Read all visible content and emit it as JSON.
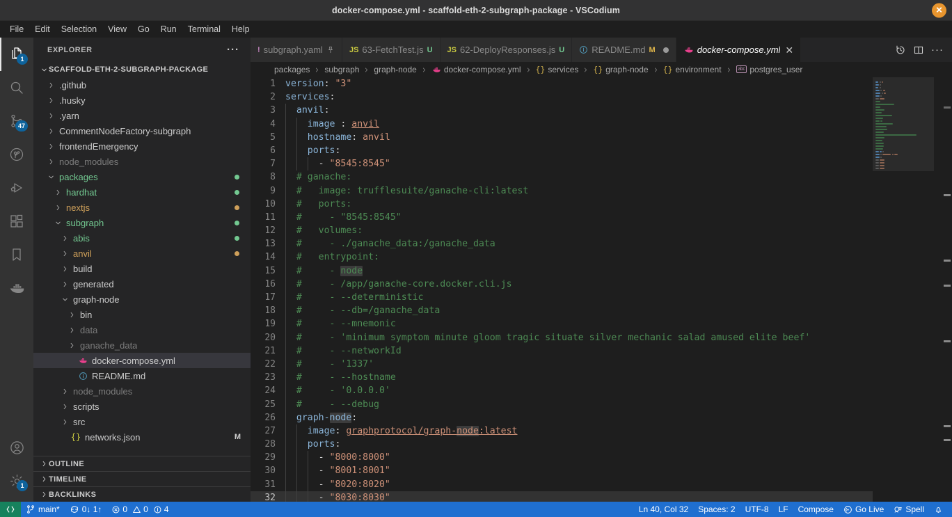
{
  "window": {
    "title": "docker-compose.yml - scaffold-eth-2-subgraph-package - VSCodium",
    "close_label": "✕"
  },
  "menubar": {
    "items": [
      "File",
      "Edit",
      "Selection",
      "View",
      "Go",
      "Run",
      "Terminal",
      "Help"
    ]
  },
  "activitybar": {
    "items": [
      {
        "name": "explorer",
        "icon": "files-icon",
        "badge": "1",
        "active": true
      },
      {
        "name": "search",
        "icon": "search-icon",
        "badge": "",
        "active": false
      },
      {
        "name": "source-control",
        "icon": "source-control-icon",
        "badge": "47",
        "active": false
      },
      {
        "name": "remote-explorer",
        "icon": "remote-explorer-icon",
        "badge": "",
        "active": false
      },
      {
        "name": "run-and-debug",
        "icon": "run-debug-icon",
        "badge": "",
        "active": false
      },
      {
        "name": "extensions",
        "icon": "extensions-icon",
        "badge": "",
        "active": false
      },
      {
        "name": "bookmarks",
        "icon": "bookmark-icon",
        "badge": "",
        "active": false
      },
      {
        "name": "docker",
        "icon": "docker-icon",
        "badge": "",
        "active": false
      }
    ],
    "bottom": [
      {
        "name": "accounts",
        "icon": "account-icon",
        "badge": ""
      },
      {
        "name": "manage",
        "icon": "gear-icon",
        "badge": "1"
      }
    ]
  },
  "sidebar": {
    "header_title": "EXPLORER",
    "more_actions": "···",
    "root_label": "SCAFFOLD-ETH-2-SUBGRAPH-PACKAGE",
    "tree": [
      {
        "label": ".github",
        "depth": 1,
        "type": "folder",
        "expanded": false,
        "color": "#cccccc",
        "dot": "",
        "badge": ""
      },
      {
        "label": ".husky",
        "depth": 1,
        "type": "folder",
        "expanded": false,
        "color": "#cccccc",
        "dot": "",
        "badge": ""
      },
      {
        "label": ".yarn",
        "depth": 1,
        "type": "folder",
        "expanded": false,
        "color": "#cccccc",
        "dot": "",
        "badge": ""
      },
      {
        "label": "CommentNodeFactory-subgraph",
        "depth": 1,
        "type": "folder",
        "expanded": false,
        "color": "#cccccc",
        "dot": "",
        "badge": ""
      },
      {
        "label": "frontendEmergency",
        "depth": 1,
        "type": "folder",
        "expanded": false,
        "color": "#cccccc",
        "dot": "",
        "badge": ""
      },
      {
        "label": "node_modules",
        "depth": 1,
        "type": "folder",
        "expanded": false,
        "color": "#7c7c7c",
        "dot": "",
        "badge": ""
      },
      {
        "label": "packages",
        "depth": 1,
        "type": "folder",
        "expanded": true,
        "color": "#73c991",
        "dot": "#73c991",
        "badge": ""
      },
      {
        "label": "hardhat",
        "depth": 2,
        "type": "folder",
        "expanded": false,
        "color": "#73c991",
        "dot": "#73c991",
        "badge": ""
      },
      {
        "label": "nextjs",
        "depth": 2,
        "type": "folder",
        "expanded": false,
        "color": "#cfa05a",
        "dot": "#cfa05a",
        "badge": ""
      },
      {
        "label": "subgraph",
        "depth": 2,
        "type": "folder",
        "expanded": true,
        "color": "#73c991",
        "dot": "#73c991",
        "badge": ""
      },
      {
        "label": "abis",
        "depth": 3,
        "type": "folder",
        "expanded": false,
        "color": "#73c991",
        "dot": "#73c991",
        "badge": ""
      },
      {
        "label": "anvil",
        "depth": 3,
        "type": "folder",
        "expanded": false,
        "color": "#cfa05a",
        "dot": "#cfa05a",
        "badge": ""
      },
      {
        "label": "build",
        "depth": 3,
        "type": "folder",
        "expanded": false,
        "color": "#cccccc",
        "dot": "",
        "badge": ""
      },
      {
        "label": "generated",
        "depth": 3,
        "type": "folder",
        "expanded": false,
        "color": "#cccccc",
        "dot": "",
        "badge": ""
      },
      {
        "label": "graph-node",
        "depth": 3,
        "type": "folder",
        "expanded": true,
        "color": "#cccccc",
        "dot": "",
        "badge": ""
      },
      {
        "label": "bin",
        "depth": 4,
        "type": "folder",
        "expanded": false,
        "color": "#cccccc",
        "dot": "",
        "badge": ""
      },
      {
        "label": "data",
        "depth": 4,
        "type": "folder",
        "expanded": false,
        "color": "#7c7c7c",
        "dot": "",
        "badge": ""
      },
      {
        "label": "ganache_data",
        "depth": 4,
        "type": "folder",
        "expanded": false,
        "color": "#7c7c7c",
        "dot": "",
        "badge": ""
      },
      {
        "label": "docker-compose.yml",
        "depth": 4,
        "type": "docker-file",
        "expanded": false,
        "color": "#cccccc",
        "dot": "",
        "badge": "",
        "selected": true
      },
      {
        "label": "README.md",
        "depth": 4,
        "type": "info-file",
        "expanded": false,
        "color": "#cccccc",
        "dot": "",
        "badge": ""
      },
      {
        "label": "node_modules",
        "depth": 3,
        "type": "folder",
        "expanded": false,
        "color": "#7c7c7c",
        "dot": "",
        "badge": ""
      },
      {
        "label": "scripts",
        "depth": 3,
        "type": "folder",
        "expanded": false,
        "color": "#cccccc",
        "dot": "",
        "badge": ""
      },
      {
        "label": "src",
        "depth": 3,
        "type": "folder",
        "expanded": false,
        "color": "#cccccc",
        "dot": "",
        "badge": ""
      },
      {
        "label": "networks.json",
        "depth": 3,
        "type": "json-file",
        "expanded": false,
        "color": "#cccccc",
        "dot": "",
        "badge": "M"
      }
    ],
    "sections": [
      "OUTLINE",
      "TIMELINE",
      "BACKLINKS"
    ]
  },
  "tabs": [
    {
      "label": "subgraph.yaml",
      "icon": "!",
      "icon_color": "#c586c0",
      "state": "pin",
      "state_text": "",
      "active": false
    },
    {
      "label": "63-FetchTest.js",
      "icon": "JS",
      "icon_color": "#cbcb41",
      "state": "u",
      "state_text": "U",
      "active": false
    },
    {
      "label": "62-DeployResponses.js",
      "icon": "JS",
      "icon_color": "#cbcb41",
      "state": "u",
      "state_text": "U",
      "active": false
    },
    {
      "label": "README.md",
      "icon": "i",
      "icon_color": "#519aba",
      "state": "mod",
      "state_text": "M",
      "active": false
    },
    {
      "label": "docker-compose.yml",
      "icon": "docker",
      "icon_color": "#e83f8c",
      "state": "close",
      "state_text": "✕",
      "active": true
    }
  ],
  "tabbar_actions": [
    "history-icon",
    "split-editor-icon",
    "more-actions-icon"
  ],
  "breadcrumbs": [
    {
      "label": "packages",
      "icon": ""
    },
    {
      "label": "subgraph",
      "icon": ""
    },
    {
      "label": "graph-node",
      "icon": ""
    },
    {
      "label": "docker-compose.yml",
      "icon": "docker"
    },
    {
      "label": "services",
      "icon": "braces"
    },
    {
      "label": "graph-node",
      "icon": "braces"
    },
    {
      "label": "environment",
      "icon": "braces"
    },
    {
      "label": "postgres_user",
      "icon": "abc"
    }
  ],
  "editor": {
    "search_term": "node",
    "first_line": 1,
    "current_line": 32,
    "lines": [
      {
        "n": 1,
        "indent": 0,
        "tokens": [
          {
            "t": "version",
            "c": "k"
          },
          {
            "t": ": ",
            "c": "p"
          },
          {
            "t": "\"3\"",
            "c": "v"
          }
        ]
      },
      {
        "n": 2,
        "indent": 0,
        "tokens": [
          {
            "t": "services",
            "c": "k"
          },
          {
            "t": ":",
            "c": "p"
          }
        ]
      },
      {
        "n": 3,
        "indent": 1,
        "tokens": [
          {
            "t": "  anvil",
            "c": "k"
          },
          {
            "t": ":",
            "c": "p"
          }
        ]
      },
      {
        "n": 4,
        "indent": 2,
        "tokens": [
          {
            "t": "    image ",
            "c": "k"
          },
          {
            "t": ": ",
            "c": "p"
          },
          {
            "t": "anvil",
            "c": "v ulink"
          }
        ]
      },
      {
        "n": 5,
        "indent": 2,
        "tokens": [
          {
            "t": "    hostname",
            "c": "k"
          },
          {
            "t": ": ",
            "c": "p"
          },
          {
            "t": "anvil",
            "c": "v"
          }
        ]
      },
      {
        "n": 6,
        "indent": 2,
        "tokens": [
          {
            "t": "    ports",
            "c": "k"
          },
          {
            "t": ":",
            "c": "p"
          }
        ]
      },
      {
        "n": 7,
        "indent": 3,
        "tokens": [
          {
            "t": "      - ",
            "c": "p"
          },
          {
            "t": "\"8545:8545\"",
            "c": "v"
          }
        ]
      },
      {
        "n": 8,
        "indent": 1,
        "tokens": [
          {
            "t": "  # ganache:",
            "c": "c"
          }
        ]
      },
      {
        "n": 9,
        "indent": 1,
        "tokens": [
          {
            "t": "  #   image: trufflesuite/ganache-cli:latest",
            "c": "c"
          }
        ]
      },
      {
        "n": 10,
        "indent": 1,
        "tokens": [
          {
            "t": "  #   ports:",
            "c": "c"
          }
        ]
      },
      {
        "n": 11,
        "indent": 1,
        "tokens": [
          {
            "t": "  #     - \"8545:8545\"",
            "c": "c"
          }
        ]
      },
      {
        "n": 12,
        "indent": 1,
        "tokens": [
          {
            "t": "  #   volumes:",
            "c": "c"
          }
        ]
      },
      {
        "n": 13,
        "indent": 1,
        "tokens": [
          {
            "t": "  #     - ./ganache_data:/ganache_data",
            "c": "c"
          }
        ]
      },
      {
        "n": 14,
        "indent": 1,
        "tokens": [
          {
            "t": "  #   entrypoint:",
            "c": "c"
          }
        ]
      },
      {
        "n": 15,
        "indent": 1,
        "tokens": [
          {
            "t": "  #     - ",
            "c": "c"
          },
          {
            "t": "node",
            "c": "c hl"
          }
        ]
      },
      {
        "n": 16,
        "indent": 1,
        "tokens": [
          {
            "t": "  #     - /app/ganache-core.docker.cli.js",
            "c": "c"
          }
        ]
      },
      {
        "n": 17,
        "indent": 1,
        "tokens": [
          {
            "t": "  #     - --deterministic",
            "c": "c"
          }
        ]
      },
      {
        "n": 18,
        "indent": 1,
        "tokens": [
          {
            "t": "  #     - --db=/ganache_data",
            "c": "c"
          }
        ]
      },
      {
        "n": 19,
        "indent": 1,
        "tokens": [
          {
            "t": "  #     - --mnemonic",
            "c": "c"
          }
        ]
      },
      {
        "n": 20,
        "indent": 1,
        "tokens": [
          {
            "t": "  #     - 'minimum symptom minute gloom tragic situate silver mechanic salad amused elite beef'",
            "c": "c"
          }
        ]
      },
      {
        "n": 21,
        "indent": 1,
        "tokens": [
          {
            "t": "  #     - --networkId",
            "c": "c"
          }
        ]
      },
      {
        "n": 22,
        "indent": 1,
        "tokens": [
          {
            "t": "  #     - '1337'",
            "c": "c"
          }
        ]
      },
      {
        "n": 23,
        "indent": 1,
        "tokens": [
          {
            "t": "  #     - --hostname",
            "c": "c"
          }
        ]
      },
      {
        "n": 24,
        "indent": 1,
        "tokens": [
          {
            "t": "  #     - '0.0.0.0'",
            "c": "c"
          }
        ]
      },
      {
        "n": 25,
        "indent": 1,
        "tokens": [
          {
            "t": "  #     - --debug",
            "c": "c"
          }
        ]
      },
      {
        "n": 26,
        "indent": 1,
        "tokens": [
          {
            "t": "  graph-",
            "c": "k"
          },
          {
            "t": "node",
            "c": "k hl"
          },
          {
            "t": ":",
            "c": "p"
          }
        ]
      },
      {
        "n": 27,
        "indent": 2,
        "tokens": [
          {
            "t": "    image",
            "c": "k"
          },
          {
            "t": ": ",
            "c": "p"
          },
          {
            "t": "graphprotocol/graph-",
            "c": "v ulink"
          },
          {
            "t": "node",
            "c": "v ulink hl"
          },
          {
            "t": ":latest",
            "c": "v ulink"
          }
        ]
      },
      {
        "n": 28,
        "indent": 2,
        "tokens": [
          {
            "t": "    ports",
            "c": "k"
          },
          {
            "t": ":",
            "c": "p"
          }
        ]
      },
      {
        "n": 29,
        "indent": 3,
        "tokens": [
          {
            "t": "      - ",
            "c": "p"
          },
          {
            "t": "\"8000:8000\"",
            "c": "v"
          }
        ]
      },
      {
        "n": 30,
        "indent": 3,
        "tokens": [
          {
            "t": "      - ",
            "c": "p"
          },
          {
            "t": "\"8001:8001\"",
            "c": "v"
          }
        ]
      },
      {
        "n": 31,
        "indent": 3,
        "tokens": [
          {
            "t": "      - ",
            "c": "p"
          },
          {
            "t": "\"8020:8020\"",
            "c": "v"
          }
        ]
      },
      {
        "n": 32,
        "indent": 3,
        "tokens": [
          {
            "t": "      - ",
            "c": "p"
          },
          {
            "t": "\"8030:8030\"",
            "c": "v"
          }
        ],
        "current": true
      }
    ]
  },
  "statusbar": {
    "remote_icon": "remote-indicator-icon",
    "left": [
      {
        "name": "branch",
        "icon": "git-branch-icon",
        "text": "main*"
      },
      {
        "name": "sync",
        "icon": "sync-icon",
        "text": "0↓ 1↑"
      },
      {
        "name": "problems",
        "icon": "errors-icon",
        "text": "0  0  4"
      }
    ],
    "errors_count": "0",
    "warnings_count": "0",
    "infos_count": "4",
    "right": [
      {
        "name": "cursor-position",
        "text": "Ln 40, Col 32"
      },
      {
        "name": "indentation",
        "text": "Spaces: 2"
      },
      {
        "name": "encoding",
        "text": "UTF-8"
      },
      {
        "name": "eol",
        "text": "LF"
      },
      {
        "name": "language-mode",
        "text": "Compose"
      },
      {
        "name": "go-live",
        "text": "Go Live",
        "icon": "broadcast-icon"
      },
      {
        "name": "spell",
        "text": "Spell",
        "icon": "spell-icon"
      },
      {
        "name": "notifications",
        "text": "",
        "icon": "bell-icon"
      }
    ]
  },
  "colors": {
    "accent": "#1f6fd0",
    "remote_green": "#16825d",
    "badge_blue": "#0e639c",
    "git_added": "#73c991",
    "git_modified": "#cfa05a",
    "docker_pink": "#e83f8c",
    "close_orange": "#e8952e"
  }
}
